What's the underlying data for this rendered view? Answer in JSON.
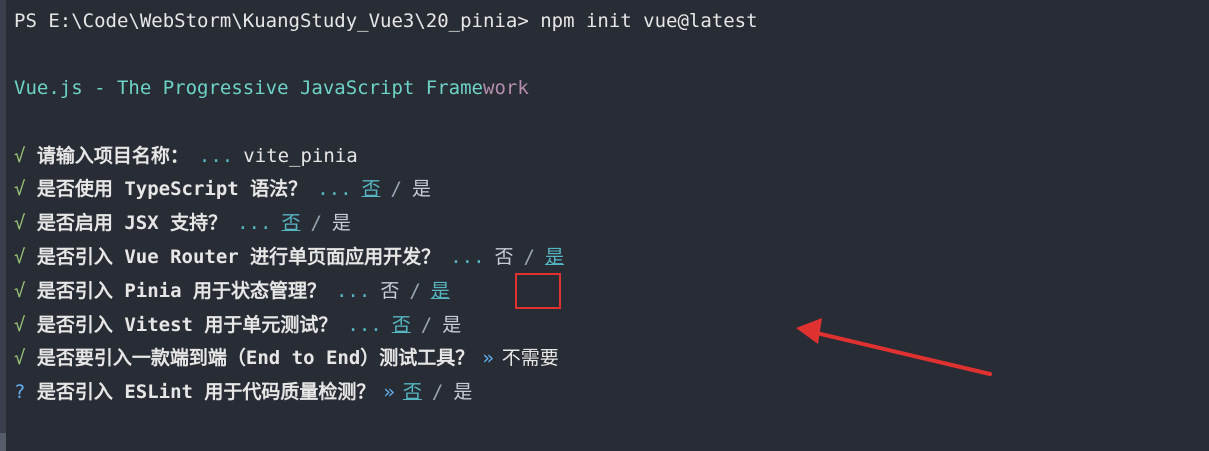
{
  "terminal": {
    "prompt_line": "PS E:\\Code\\WebStorm\\KuangStudy_Vue3\\20_pinia> npm init vue@latest",
    "banner_main": "Vue.js - The Progressive JavaScript Frame",
    "banner_tail": "work",
    "check_symbol": "√",
    "pending_symbol": "?",
    "dots": "...",
    "chevron": "»",
    "separator": "/",
    "lines": [
      {
        "question": "请输入项目名称：",
        "answer": "vite_pinia"
      },
      {
        "question": "是否使用 TypeScript 语法？",
        "opt_no": "否",
        "opt_yes": "是",
        "selected": "no"
      },
      {
        "question": "是否启用 JSX 支持？",
        "opt_no": "否",
        "opt_yes": "是",
        "selected": "no"
      },
      {
        "question": "是否引入 Vue Router 进行单页面应用开发？",
        "opt_no": "否",
        "opt_yes": "是",
        "selected": "yes"
      },
      {
        "question": "是否引入 Pinia 用于状态管理？",
        "opt_no": "否",
        "opt_yes": "是",
        "selected": "yes"
      },
      {
        "question": "是否引入 Vitest 用于单元测试？",
        "opt_no": "否",
        "opt_yes": "是",
        "selected": "no"
      },
      {
        "question": "是否要引入一款端到端（End to End）测试工具？",
        "answer": "不需要"
      },
      {
        "question": "是否引入 ESLint 用于代码质量检测？",
        "opt_no": "否",
        "opt_yes": "是",
        "selected": "no"
      }
    ],
    "colors": {
      "background": "#282c34",
      "check": "#98c379",
      "selected_option": "#56b6c2",
      "annotation": "#e03131"
    }
  }
}
